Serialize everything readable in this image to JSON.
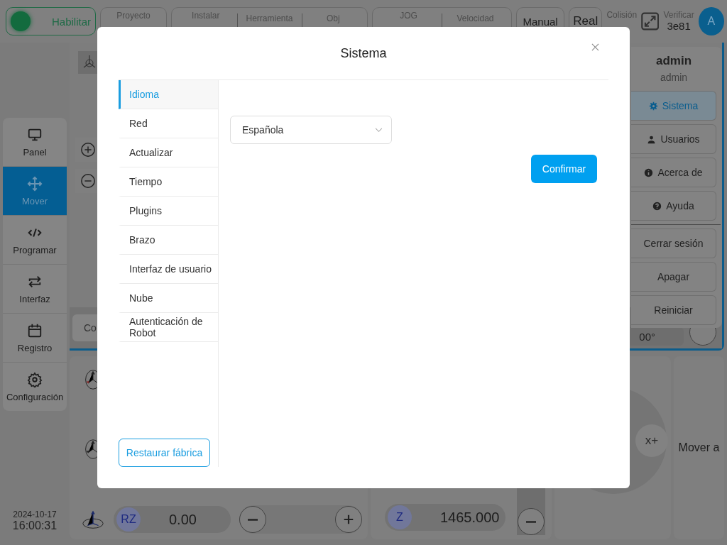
{
  "topbar": {
    "enable_button": {
      "label": "Habilitar",
      "on": true
    },
    "status_groups": [
      [
        {
          "label": "Proyecto"
        }
      ],
      [
        {
          "label": "Instalar"
        },
        {
          "label": "Herramienta"
        },
        {
          "label": "Obj"
        }
      ],
      [
        {
          "label": "JOG"
        },
        {
          "label": "Velocidad"
        }
      ]
    ],
    "mode_buttons": [
      "Manual",
      "Real"
    ],
    "collision": {
      "label": "Colisión"
    },
    "verify": {
      "label": "Verificar",
      "value": "3e81"
    },
    "avatar": "A"
  },
  "sidebar": {
    "items": [
      {
        "label": "Panel",
        "selected": false
      },
      {
        "label": "Mover",
        "selected": true
      },
      {
        "label": "Programar",
        "selected": false
      },
      {
        "label": "Interfaz",
        "selected": false
      },
      {
        "label": "Registro",
        "selected": false
      },
      {
        "label": "Configuración",
        "selected": false
      }
    ],
    "date": "2024-10-17",
    "time": "16:00:31"
  },
  "view": {
    "field": "Co",
    "reading": "00°"
  },
  "user_menu": {
    "name": "admin",
    "role": "admin",
    "items": [
      {
        "label": "Sistema",
        "selected": true
      },
      {
        "label": "Usuarios",
        "selected": false
      },
      {
        "label": "Acerca de",
        "selected": false
      },
      {
        "label": "Ayuda",
        "selected": false
      }
    ],
    "power_items": [
      "Cerrar sesión",
      "Apagar",
      "Reiniciar"
    ]
  },
  "jog": {
    "axis": "RZ",
    "value": "0.00",
    "z_axis": "Z",
    "z_value": "1465.000",
    "joystick_label": "x+",
    "move_button": "Mover a"
  },
  "dialog": {
    "title": "Sistema",
    "tabs": [
      {
        "label": "Idioma",
        "selected": true
      },
      {
        "label": "Red",
        "selected": false
      },
      {
        "label": "Actualizar",
        "selected": false
      },
      {
        "label": "Tiempo",
        "selected": false
      },
      {
        "label": "Plugins",
        "selected": false
      },
      {
        "label": "Brazo",
        "selected": false
      },
      {
        "label": "Interfaz de usuario",
        "selected": false
      },
      {
        "label": "Nube",
        "selected": false
      },
      {
        "label": "Autenticación de Robot",
        "selected": false
      }
    ],
    "reset_button": "Restaurar fábrica",
    "language": "Española",
    "confirm_button": "Confirmar"
  }
}
